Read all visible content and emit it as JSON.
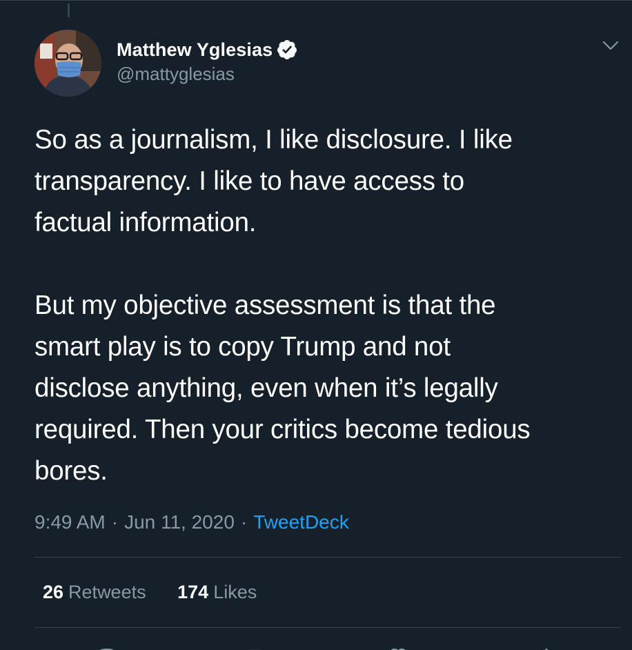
{
  "author": {
    "display_name": "Matthew Yglesias",
    "handle": "@mattyglesias",
    "verified": true,
    "avatar_icon": "avatar-photo-masked-man"
  },
  "tweet": {
    "paragraphs": [
      "So as a journalism, I like disclosure. I like\ntransparency. I like to have access to\nfactual information.",
      "But my objective assessment is that the\nsmart play is to copy Trump and not\ndisclose anything, even when it’s legally\nrequired. Then your critics become tedious\nbores."
    ]
  },
  "meta": {
    "time": "9:49 AM",
    "separator": "·",
    "date": "Jun 11, 2020",
    "source": "TweetDeck"
  },
  "stats": {
    "retweets_count": "26",
    "retweets_label": "Retweets",
    "likes_count": "174",
    "likes_label": "Likes"
  },
  "colors": {
    "background": "#15202b",
    "divider": "#38444d",
    "secondary_text": "#8899a6",
    "link": "#1da1f2"
  }
}
